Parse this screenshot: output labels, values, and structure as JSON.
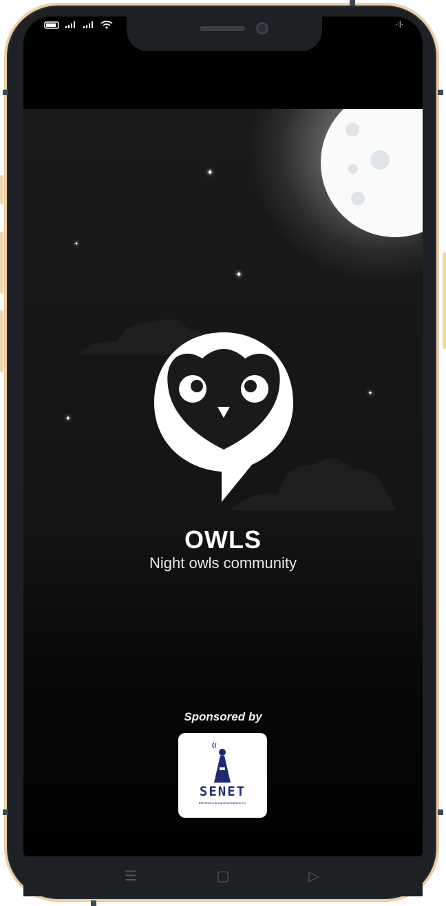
{
  "status_bar": {
    "signal_text": "ıl ıl",
    "right_text": "·:|·"
  },
  "app": {
    "title": "OWLS",
    "subtitle": "Night owls community"
  },
  "sponsor": {
    "label": "Sponsored by",
    "name": "SENET",
    "tagline": "Electronics & Communications Co."
  },
  "nav": {
    "menu_icon": "☰",
    "home_icon": "▢",
    "back_icon": "▷"
  },
  "colors": {
    "background": "#000000",
    "frame": "#1d2024",
    "frame_border": "#eccfa5",
    "sponsor_brand": "#1f2a6e"
  },
  "icons": [
    "battery-icon",
    "signal-icon",
    "wifi-icon",
    "moon-icon",
    "star-icon",
    "owl-logo-icon",
    "menu-icon",
    "home-icon",
    "back-icon"
  ]
}
